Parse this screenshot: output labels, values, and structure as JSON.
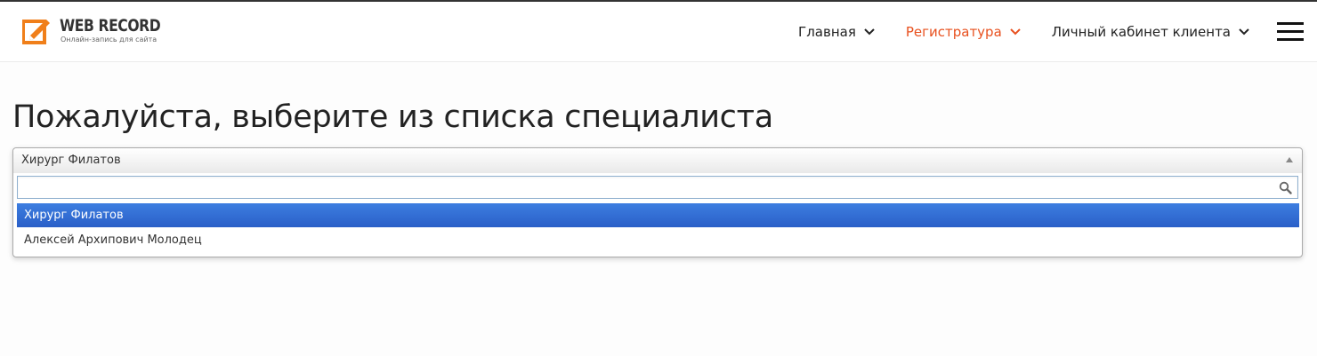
{
  "header": {
    "logo_title": "WEB RECORD",
    "logo_subtitle": "Онлайн-запись для сайта",
    "nav": [
      {
        "label": "Главная",
        "active": false
      },
      {
        "label": "Регистратура",
        "active": true
      },
      {
        "label": "Личный кабинет клиента",
        "active": false
      }
    ]
  },
  "colors": {
    "accent": "#e8501e",
    "highlight": "#3373d6"
  },
  "main": {
    "title": "Пожалуйста, выберите из списка специалиста",
    "select": {
      "selected_value": "Хирург Филатов",
      "search_value": "",
      "search_placeholder": "",
      "options": [
        {
          "label": "Хирург Филатов",
          "highlighted": true
        },
        {
          "label": "Алексей Архипович Молодец",
          "highlighted": false
        }
      ]
    }
  }
}
